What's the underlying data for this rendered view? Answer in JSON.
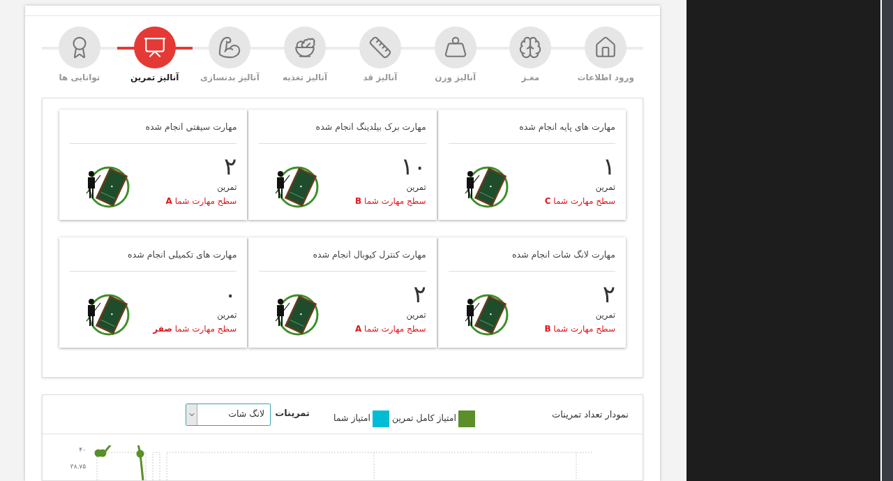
{
  "steps": [
    {
      "label": "ورود اطلاعات",
      "kind": "home",
      "selected": false
    },
    {
      "label": "مغـز",
      "kind": "brain",
      "selected": false
    },
    {
      "label": "آنالیز وزن",
      "kind": "scale",
      "selected": false
    },
    {
      "label": "آنالیز قد",
      "kind": "height",
      "selected": false
    },
    {
      "label": "آنالیز تغذیه",
      "kind": "food",
      "selected": false
    },
    {
      "label": "آنالیز بدنسازی",
      "kind": "muscle",
      "selected": false
    },
    {
      "label": "آنالیز تمرین",
      "kind": "training",
      "selected": true
    },
    {
      "label": "توانایی ها",
      "kind": "abilities",
      "selected": false
    }
  ],
  "skill_cards": [
    {
      "title": "مهارت های پایه انجام شده",
      "count": "۱",
      "unit": "تمرین",
      "grade": "سطح مهارت شما **C**"
    },
    {
      "title": "مهارت برک بیلدینگ انجام شده",
      "count": "۱۰",
      "unit": "تمرین",
      "grade": "سطح مهارت شما **B**"
    },
    {
      "title": "مهارت سیفتی انجام شده",
      "count": "۲",
      "unit": "تمرین",
      "grade": "سطح مهارت شما **A**"
    },
    {
      "title": "مهارت لانگ شات انجام شده",
      "count": "۲",
      "unit": "تمرین",
      "grade": "سطح مهارت شما **B**"
    },
    {
      "title": "مهارت کنترل کیوبال انجام شده",
      "count": "۲",
      "unit": "تمرین",
      "grade": "سطح مهارت شما **A**"
    },
    {
      "title": "مهارت های تکمیلی انجام شده",
      "count": "۰",
      "unit": "تمرین",
      "grade": "سطح مهارت شما **صفر**"
    }
  ],
  "chart_panel": {
    "title": "نمودار تعداد تمرینات",
    "legend": [
      {
        "label": "امتیاز کامل تمرین",
        "color": "#5a8f29"
      },
      {
        "label": "امتیاز شما",
        "color": "#00bcd4"
      }
    ],
    "filter_label": "تمرینات",
    "filter_value": "لانگ شات",
    "y_axis_labels": [
      "۴۰",
      "۳۸.۷۵"
    ]
  }
}
